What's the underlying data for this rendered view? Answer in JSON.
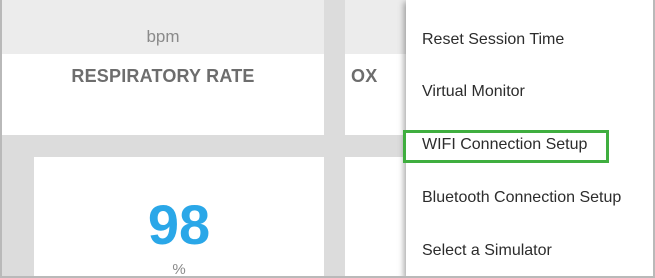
{
  "respiratory_panel": {
    "unit_top": "bpm",
    "label": "RESPIRATORY RATE"
  },
  "oxygen_panel": {
    "label_fragment": "OX"
  },
  "spo2_panel": {
    "value": "98",
    "unit": "%"
  },
  "menu": {
    "items": [
      {
        "label": "Reset Session Time"
      },
      {
        "label": "Virtual Monitor"
      },
      {
        "label": "WIFI Connection Setup",
        "highlighted": true
      },
      {
        "label": "Bluetooth Connection Setup"
      },
      {
        "label": "Select a Simulator"
      }
    ]
  },
  "colors": {
    "value_accent": "#2aa7e8",
    "highlight_border": "#3fae3f"
  }
}
